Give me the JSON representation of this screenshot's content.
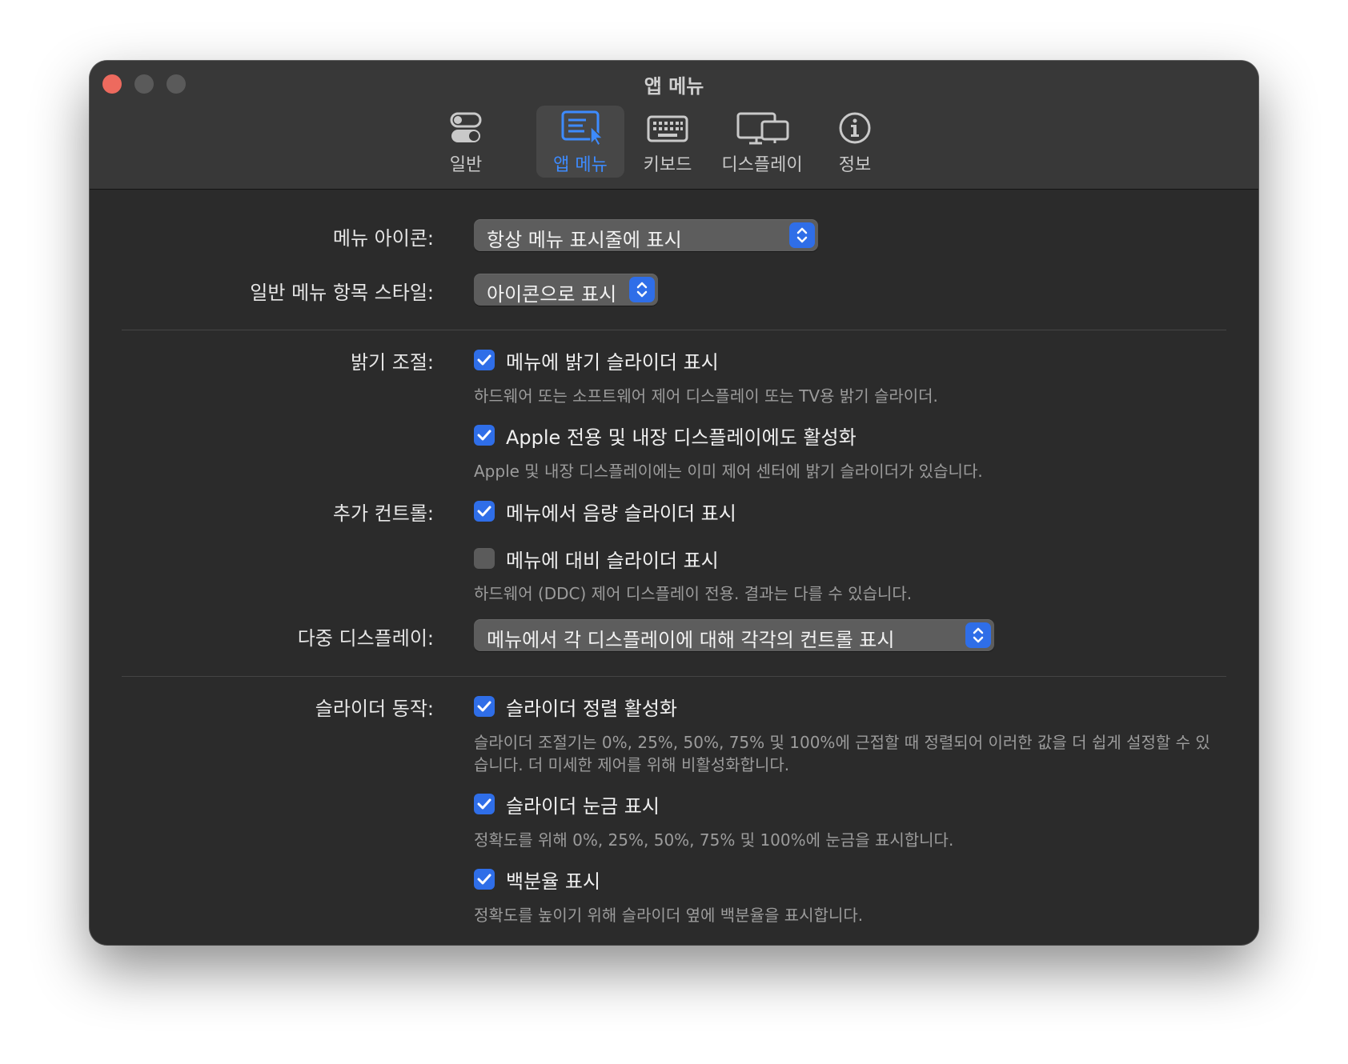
{
  "window": {
    "title": "앱 메뉴"
  },
  "tabs": [
    {
      "label": "일반",
      "icon": "toggle-icon",
      "active": false
    },
    {
      "label": "앱 메뉴",
      "icon": "menu-cursor-icon",
      "active": true
    },
    {
      "label": "키보드",
      "icon": "keyboard-icon",
      "active": false
    },
    {
      "label": "디스플레이",
      "icon": "displays-icon",
      "active": false
    },
    {
      "label": "정보",
      "icon": "info-icon",
      "active": false
    }
  ],
  "menu_icon": {
    "label": "메뉴 아이콘:",
    "value": "항상 메뉴 표시줄에 표시"
  },
  "menu_item_style": {
    "label": "일반 메뉴 항목 스타일:",
    "value": "아이콘으로 표시"
  },
  "brightness": {
    "label": "밝기 조절:",
    "show_slider": {
      "label": "메뉴에 밝기 슬라이더 표시",
      "checked": true,
      "note": "하드웨어 또는 소프트웨어 제어 디스플레이 또는 TV용 밝기 슬라이더."
    },
    "apple_builtin": {
      "label": "Apple 전용 및 내장 디스플레이에도 활성화",
      "checked": true,
      "note": "Apple 및 내장 디스플레이에는 이미 제어 센터에 밝기 슬라이더가 있습니다."
    }
  },
  "extra_controls": {
    "label": "추가 컨트롤:",
    "volume": {
      "label": "메뉴에서 음량 슬라이더 표시",
      "checked": true
    },
    "contrast": {
      "label": "메뉴에 대비 슬라이더 표시",
      "checked": false,
      "note": "하드웨어 (DDC) 제어 디스플레이 전용. 결과는 다를 수 있습니다."
    }
  },
  "multi_display": {
    "label": "다중 디스플레이:",
    "value": "메뉴에서 각 디스플레이에 대해 각각의 컨트롤 표시"
  },
  "slider_behavior": {
    "label": "슬라이더 동작:",
    "snap": {
      "label": "슬라이더 정렬 활성화",
      "checked": true,
      "note": "슬라이더 조절기는 0%, 25%, 50%, 75% 및 100%에 근접할 때 정렬되어 이러한 값을 더 쉽게 설정할 수 있습니다. 더 미세한 제어를 위해 비활성화합니다."
    },
    "ticks": {
      "label": "슬라이더 눈금 표시",
      "checked": true,
      "note": "정확도를 위해 0%, 25%, 50%, 75% 및 100%에 눈금을 표시합니다."
    },
    "percent": {
      "label": "백분율 표시",
      "checked": true,
      "note": "정확도를 높이기 위해 슬라이더 옆에 백분율을 표시합니다."
    }
  },
  "colors": {
    "accent": "#2f6ee8",
    "window_bg": "#2b2b2b",
    "close": "#ed6a5e"
  }
}
